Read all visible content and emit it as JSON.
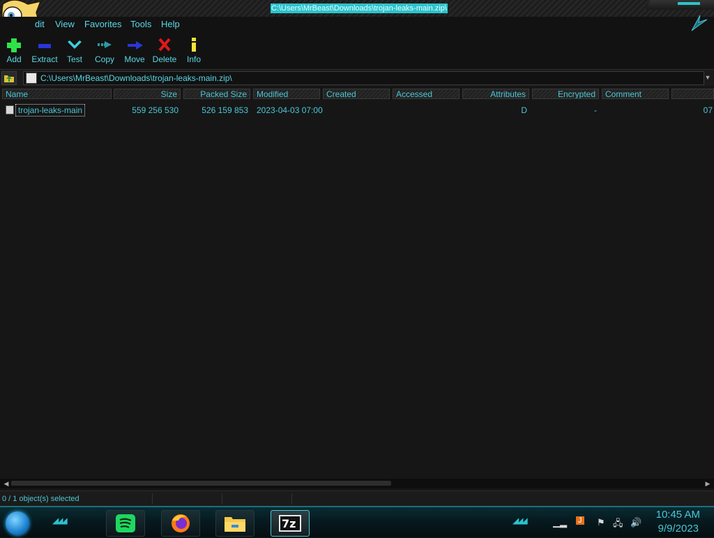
{
  "window": {
    "title": "C:\\Users\\MrBeast\\Downloads\\trojan-leaks-main.zip\\"
  },
  "menu": [
    "dit",
    "View",
    "Favorites",
    "Tools",
    "Help"
  ],
  "toolbar": {
    "add": "Add",
    "extract": "Extract",
    "test": "Test",
    "copy": "Copy",
    "move": "Move",
    "delete": "Delete",
    "info": "Info"
  },
  "address": {
    "path": "C:\\Users\\MrBeast\\Downloads\\trojan-leaks-main.zip\\"
  },
  "columns": [
    "Name",
    "Size",
    "Packed Size",
    "Modified",
    "Created",
    "Accessed",
    "Attributes",
    "Encrypted",
    "Comment"
  ],
  "rows": [
    {
      "name": "trojan-leaks-main",
      "size": "559 256 530",
      "packed": "526 159 853",
      "modified": "2023-04-03 07:00",
      "created": "",
      "accessed": "",
      "attributes": "D",
      "encrypted": "-",
      "comment": "",
      "overflow": "07"
    }
  ],
  "status": {
    "selection": "0 / 1 object(s) selected"
  },
  "taskbar": {
    "apps": [
      "spotify-icon",
      "firefox-icon",
      "file-explorer-icon",
      "7zip-icon"
    ],
    "sevenzip_label": "7z",
    "clock_time": "10:45 AM",
    "clock_date": "9/9/2023"
  },
  "colors": {
    "accent": "#2cc3cc",
    "text": "#4ac7d6",
    "background": "#161616"
  }
}
